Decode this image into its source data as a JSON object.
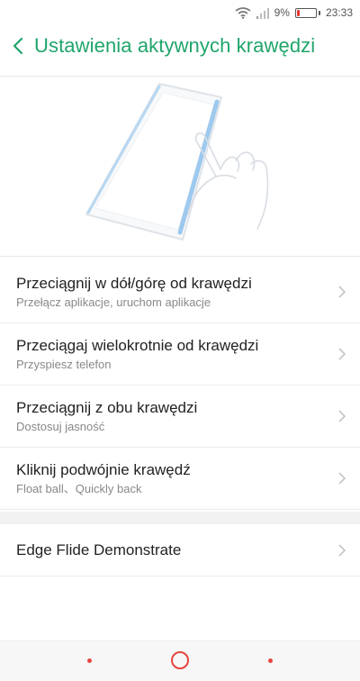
{
  "status_bar": {
    "battery_percent": "9%",
    "battery_level": 0.09,
    "time": "23:33",
    "icons": [
      "wifi-icon",
      "signal-icon",
      "battery-icon"
    ]
  },
  "header": {
    "title": "Ustawienia aktywnych krawędzi",
    "back_icon": "chevron-left-icon"
  },
  "settings": {
    "items": [
      {
        "title": "Przeciągnij w dół/górę od krawędzi",
        "subtitle": "Przełącz aplikacje, uruchom aplikacje"
      },
      {
        "title": "Przeciągaj wielokrotnie od krawędzi",
        "subtitle": "Przyspiesz telefon"
      },
      {
        "title": "Przeciągnij z obu krawędzi",
        "subtitle": "Dostosuj jasność"
      },
      {
        "title": "Kliknij podwójnie krawędź",
        "subtitle": "Float ball、Quickly back"
      }
    ],
    "demo": {
      "title": "Edge Flide Demonstrate"
    }
  },
  "nav_bar": {
    "icons": [
      "recent-apps-icon",
      "home-icon",
      "back-icon"
    ]
  },
  "colors": {
    "accent": "#1fa56a",
    "nav": "#e5463f",
    "battery_low": "#e53935"
  }
}
